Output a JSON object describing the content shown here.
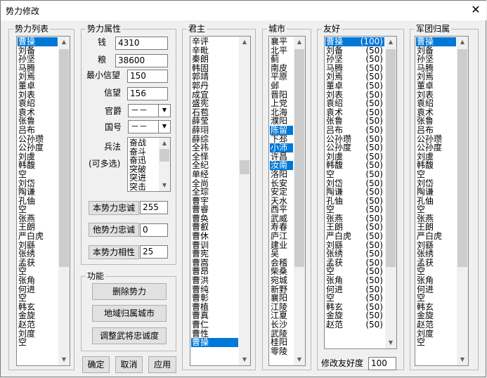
{
  "window": {
    "title": "势力修改",
    "close": "✕"
  },
  "force_list": {
    "label": "势力列表",
    "items": [
      "曹操",
      "刘备",
      "孙坚",
      "马腾",
      "刘焉",
      "董卓",
      "刘表",
      "袁绍",
      "袁术",
      "张鲁",
      "吕布",
      "公孙瓒",
      "公孙度",
      "刘虞",
      "韩馥",
      "空",
      "刘岱",
      "陶谦",
      "孔伷",
      "空",
      "张燕",
      "王朗",
      "严白虎",
      "刘繇",
      "张绣",
      "孟获",
      "空",
      "张角",
      "何进",
      "空",
      "韩玄",
      "金旋",
      "赵范",
      "刘度",
      "空"
    ],
    "selected": 0
  },
  "attrs": {
    "label": "势力属性",
    "money_label": "钱",
    "money": "4310",
    "food_label": "粮",
    "food": "38600",
    "min_trust_label": "最小信望",
    "min_trust": "150",
    "trust_label": "信望",
    "trust": "156",
    "title_label": "官爵",
    "title_value": "－－",
    "country_label": "国号",
    "country_value": "－－",
    "tactics_label": "兵法",
    "multi_label": "(可多选)",
    "tactics": [
      "奋战",
      "奋斗",
      "奋迅",
      "突破",
      "突进",
      "突击"
    ],
    "loyalty_label": "本势力忠诚",
    "loyalty": "255",
    "other_loyalty_label": "他势力忠诚",
    "other_loyalty": "0",
    "affinity_label": "本势力相性",
    "affinity": "25"
  },
  "functions": {
    "label": "功能",
    "delete": "删除势力",
    "region": "地域归属城市",
    "adjust": "调整武将忠诚度"
  },
  "footer": {
    "ok": "确定",
    "cancel": "取消",
    "apply": "应用"
  },
  "lords": {
    "label": "君主",
    "items": [
      "辛评",
      "辛毗",
      "秦朗",
      "韩固",
      "郭靖",
      "郭丹",
      "成宜",
      "盛宪",
      "石苞",
      "薛莹",
      "薛珝",
      "薛综",
      "全祎",
      "全怿",
      "全纪",
      "单经",
      "全尚",
      "全琮",
      "曹宇",
      "曹睿",
      "曹奂",
      "曹叡",
      "曹休",
      "曹训",
      "曹宪",
      "曹嵩",
      "曹昂",
      "曹洪",
      "曹纯",
      "曹彰",
      "曹植",
      "曹真",
      "曹仁",
      "曹性",
      "曹操"
    ],
    "selected": 34
  },
  "cities": {
    "label": "城市",
    "items": [
      "襄平",
      "北平",
      "蓟",
      "南皮",
      "平原",
      "邺",
      "晋阳",
      "上党",
      "北海",
      "濮阳",
      "陈留",
      "下邳",
      "小沛",
      "许昌",
      "汝南",
      "洛阳",
      "长安",
      "安定",
      "天水",
      "西平",
      "武威",
      "寿春",
      "庐江",
      "建业",
      "吴",
      "会稽",
      "柴桑",
      "宛城",
      "新野",
      "襄阳",
      "江陵",
      "江夏",
      "长沙",
      "武陵",
      "桂阳",
      "零陵"
    ],
    "selected": [
      10,
      12,
      14
    ]
  },
  "friendship": {
    "label": "友好",
    "rows": [
      [
        "曹操",
        "(100)"
      ],
      [
        "刘备",
        "(50)"
      ],
      [
        "孙坚",
        "(50)"
      ],
      [
        "马腾",
        "(50)"
      ],
      [
        "刘焉",
        "(50)"
      ],
      [
        "董卓",
        "(50)"
      ],
      [
        "刘表",
        "(50)"
      ],
      [
        "袁绍",
        "(50)"
      ],
      [
        "袁术",
        "(50)"
      ],
      [
        "张鲁",
        "(50)"
      ],
      [
        "吕布",
        "(50)"
      ],
      [
        "公孙瓒",
        "(50)"
      ],
      [
        "公孙度",
        "(50)"
      ],
      [
        "刘虞",
        "(50)"
      ],
      [
        "韩馥",
        "(50)"
      ],
      [
        "空",
        "(50)"
      ],
      [
        "刘岱",
        "(50)"
      ],
      [
        "陶谦",
        "(50)"
      ],
      [
        "孔伷",
        "(50)"
      ],
      [
        "空",
        "(50)"
      ],
      [
        "张燕",
        "(50)"
      ],
      [
        "王朗",
        "(50)"
      ],
      [
        "严白虎",
        "(50)"
      ],
      [
        "刘繇",
        "(50)"
      ],
      [
        "张绣",
        "(50)"
      ],
      [
        "孟获",
        "(50)"
      ],
      [
        "空",
        "(50)"
      ],
      [
        "张角",
        "(50)"
      ],
      [
        "何进",
        "(50)"
      ],
      [
        "空",
        "(50)"
      ],
      [
        "韩玄",
        "(50)"
      ],
      [
        "金旋",
        "(50)"
      ],
      [
        "赵范",
        "(50)"
      ]
    ],
    "selected": 0,
    "edit_label": "修改友好度",
    "edit_value": "100"
  },
  "army": {
    "label": "军团归属",
    "items": [
      "曹操",
      "刘备",
      "孙坚",
      "马腾",
      "刘焉",
      "董卓",
      "刘表",
      "袁绍",
      "袁术",
      "张鲁",
      "吕布",
      "公孙瓒",
      "公孙度",
      "刘虞",
      "韩馥",
      "空",
      "刘岱",
      "陶谦",
      "孔伷",
      "空",
      "张燕",
      "王朗",
      "严白虎",
      "刘繇",
      "张绣",
      "孟获",
      "空",
      "张角",
      "何进",
      "空",
      "韩玄",
      "金旋",
      "赵范",
      "刘度",
      "空"
    ],
    "selected": 0
  }
}
